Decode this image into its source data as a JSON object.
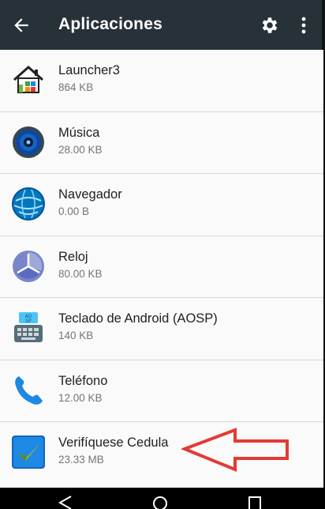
{
  "appbar": {
    "title": "Aplicaciones",
    "back_icon": "arrow-back-icon",
    "settings_icon": "gear-icon",
    "overflow_icon": "more-vert-icon",
    "background": "#263238"
  },
  "apps": [
    {
      "name": "Launcher3",
      "size": "864 KB",
      "icon": "launcher-home-icon"
    },
    {
      "name": "Música",
      "size": "28.00 KB",
      "icon": "music-speaker-icon"
    },
    {
      "name": "Navegador",
      "size": "0.00 B",
      "icon": "browser-globe-icon"
    },
    {
      "name": "Reloj",
      "size": "80.00 KB",
      "icon": "clock-icon"
    },
    {
      "name": "Teclado de Android (AOSP)",
      "size": "140 KB",
      "icon": "keyboard-icon"
    },
    {
      "name": "Teléfono",
      "size": "12.00 KB",
      "icon": "phone-icon"
    },
    {
      "name": "Verifíquese Cedula",
      "size": "23.33 MB",
      "icon": "verify-check-icon"
    }
  ],
  "annotation": {
    "icon": "red-arrow-annotation",
    "color": "#e53935"
  }
}
